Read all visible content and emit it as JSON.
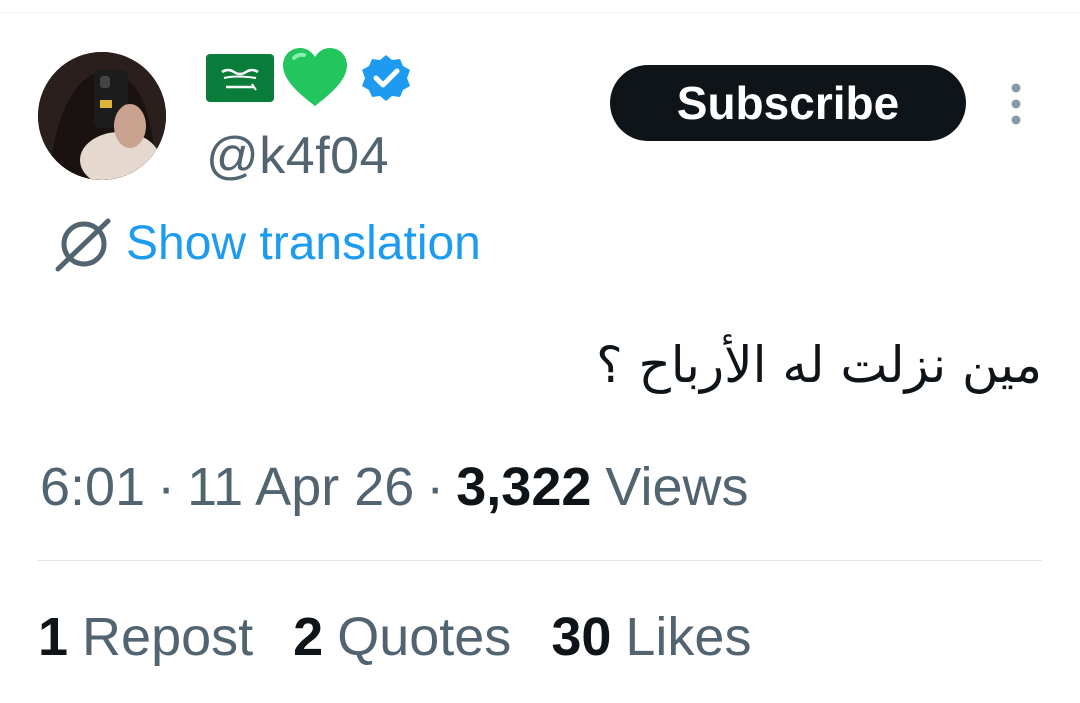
{
  "author": {
    "handle": "@k4f04",
    "badges": [
      "saudi-flag-icon",
      "green-heart-icon",
      "verified-icon"
    ]
  },
  "actions": {
    "subscribe_label": "Subscribe",
    "more_icon": "more-vertical-icon"
  },
  "translation": {
    "label": "Show translation",
    "icon": "translate-icon"
  },
  "tweet": {
    "text": "مين نزلت له الأرباح ؟"
  },
  "meta": {
    "time": "6:01",
    "separator": "·",
    "date": "11 Apr 26",
    "views_count": "3,322",
    "views_label": "Views"
  },
  "stats": [
    {
      "count": "1",
      "label": "Repost"
    },
    {
      "count": "2",
      "label": "Quotes"
    },
    {
      "count": "30",
      "label": "Likes"
    }
  ],
  "colors": {
    "accent": "#1d9bf0",
    "text_primary": "#0f1419",
    "text_secondary": "#536471",
    "heart": "#22c55e",
    "flag": "#0a7d3b",
    "subscribe_bg": "#0f1419"
  }
}
